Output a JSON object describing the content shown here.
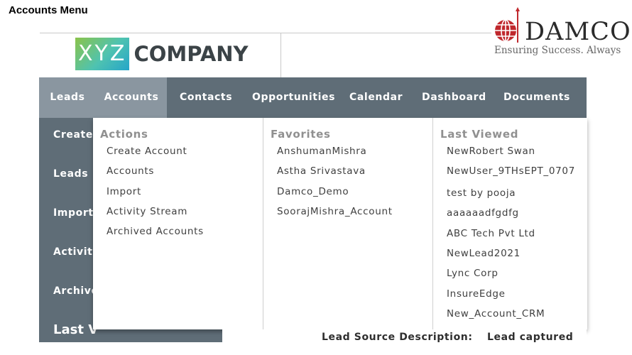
{
  "slide_title": "Accounts Menu",
  "brand": {
    "xyz_prefix": "XYZ",
    "xyz_suffix": "COMPANY",
    "damco_word": "DAMCO",
    "damco_tagline": "Ensuring Success. Always",
    "damco_colors": {
      "globe": "#c0282d",
      "text": "#2b2b2b"
    }
  },
  "nav": {
    "items": [
      "Leads",
      "Accounts",
      "Contacts",
      "Opportunities",
      "Calendar",
      "Dashboard",
      "Documents"
    ],
    "active": "Accounts",
    "colors": {
      "bar": "#5f6d77",
      "active": "#8a96a0"
    }
  },
  "sidebar": {
    "items": [
      "Create L",
      "Leads",
      "Import",
      "Activity",
      "Archive"
    ],
    "last_viewed": "Last V"
  },
  "dropdown": {
    "actions": {
      "heading": "Actions",
      "links": [
        "Create Account",
        "Accounts",
        "Import",
        "Activity Stream",
        "Archived Accounts"
      ]
    },
    "favorites": {
      "heading": "Favorites",
      "links": [
        "AnshumanMishra",
        "Astha Srivastava",
        "Damco_Demo",
        "SoorajMishra_Account"
      ]
    },
    "last_viewed": {
      "heading": "Last Viewed",
      "links": [
        "NewRobert Swan",
        "NewUser_9THsEPT_0707",
        "test by pooja",
        "aaaaaadfgdfg",
        "ABC Tech Pvt Ltd",
        "NewLead2021",
        "Lync Corp",
        "InsureEdge",
        "New_Account_CRM"
      ]
    }
  },
  "bottom": {
    "label": "Lead Source Description:",
    "value": "Lead captured"
  }
}
